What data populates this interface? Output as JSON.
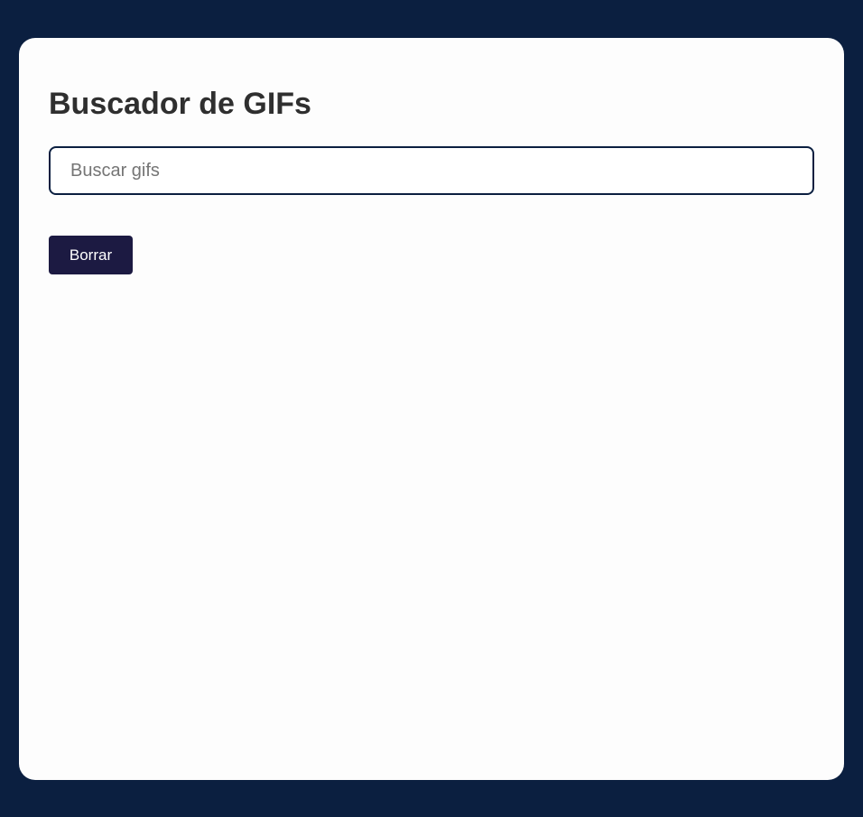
{
  "header": {
    "title": "Buscador de GIFs"
  },
  "search": {
    "value": "",
    "placeholder": "Buscar gifs"
  },
  "actions": {
    "clear_label": "Borrar"
  },
  "colors": {
    "page_background": "#0b1f40",
    "card_background": "#fdfdfd",
    "button_background": "#1c1a42",
    "input_border": "#0b1f40"
  }
}
